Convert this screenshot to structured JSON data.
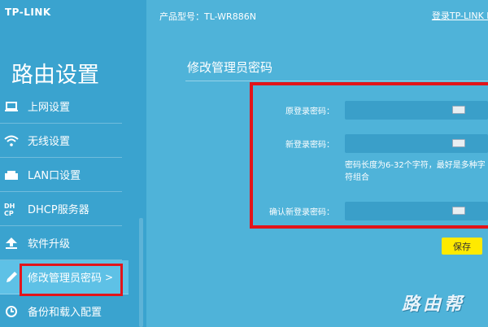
{
  "brand": {
    "logo": "TP-LINK"
  },
  "sidebar": {
    "title": "路由设置",
    "items": [
      {
        "label": "上网设置",
        "icon": "laptop-icon"
      },
      {
        "label": "无线设置",
        "icon": "wifi-icon"
      },
      {
        "label": "LAN口设置",
        "icon": "lan-port-icon"
      },
      {
        "label": "DHCP服务器",
        "icon": "dhcp-icon"
      },
      {
        "label": "软件升级",
        "icon": "upload-icon"
      },
      {
        "label": "修改管理员密码",
        "icon": "pencil-icon",
        "chevron": ">",
        "active": true
      },
      {
        "label": "备份和载入配置",
        "icon": "backup-icon"
      }
    ]
  },
  "header": {
    "model": "产品型号：TL-WR886N",
    "login_link": "登录TP-LINK ID"
  },
  "main": {
    "title": "修改管理员密码",
    "fields": {
      "old_password": {
        "label": "原登录密码：",
        "value": ""
      },
      "new_password": {
        "label": "新登录密码：",
        "value": ""
      },
      "confirm_password": {
        "label": "确认新登录密码：",
        "value": ""
      }
    },
    "hint": "密码长度为6-32个字符，最好是多种字符组合",
    "save_label": "保存"
  },
  "watermark": "路由帮",
  "colors": {
    "background": "#4fb3d9",
    "sidebar": "#3aa3cf",
    "highlight_box": "#e2141a",
    "save_button": "#ffea00"
  }
}
